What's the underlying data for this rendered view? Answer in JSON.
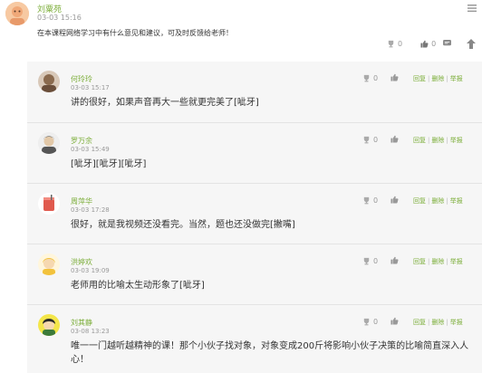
{
  "post": {
    "author": "刘粟苑",
    "time": "03-03 15:16",
    "content": "在本课程网络学习中有什么意见和建议，可及时反馈给老师！",
    "vote_count": "0",
    "like_count": "0"
  },
  "replies": [
    {
      "author": "何玲玲",
      "time": "03-03 15:17",
      "content": "讲的很好，如果声音再大一些就更完美了[呲牙]",
      "vote_count": "0",
      "avatar_color": "#8a6a4e"
    },
    {
      "author": "罗万余",
      "time": "03-03 15:49",
      "content": "[呲牙][呲牙][呲牙]",
      "vote_count": "0",
      "avatar_color": "#c9b8a2"
    },
    {
      "author": "周萍华",
      "time": "03-03 17:28",
      "content": "很好，就是我视频还没看完。当然，题也还没做完[撇嘴]",
      "vote_count": "0",
      "avatar_color": "#e05a4e"
    },
    {
      "author": "洪婷欢",
      "time": "03-03 19:09",
      "content": "老师用的比喻太生动形象了[呲牙]",
      "vote_count": "0",
      "avatar_color": "#f2c23c"
    },
    {
      "author": "刘其静",
      "time": "03-08 13:23",
      "content": "唯一一门越听越精神的课！那个小伙子找对象，对象变成200斤将影响小伙子决策的比喻简直深入人心！",
      "vote_count": "0",
      "avatar_color": "#3c7a3a"
    }
  ],
  "reply_actions": {
    "reply": "回复",
    "delete": "删除",
    "report": "举报",
    "sep": "|"
  },
  "icons": {
    "vote": "trophy-icon",
    "like": "thumbs-up-icon",
    "comment": "comment-icon",
    "menu": "hamburger-menu-icon",
    "up": "arrow-up-icon"
  },
  "colors": {
    "accent": "#7cae3a",
    "reply_bg": "#f6f6f6",
    "muted": "#999999"
  }
}
